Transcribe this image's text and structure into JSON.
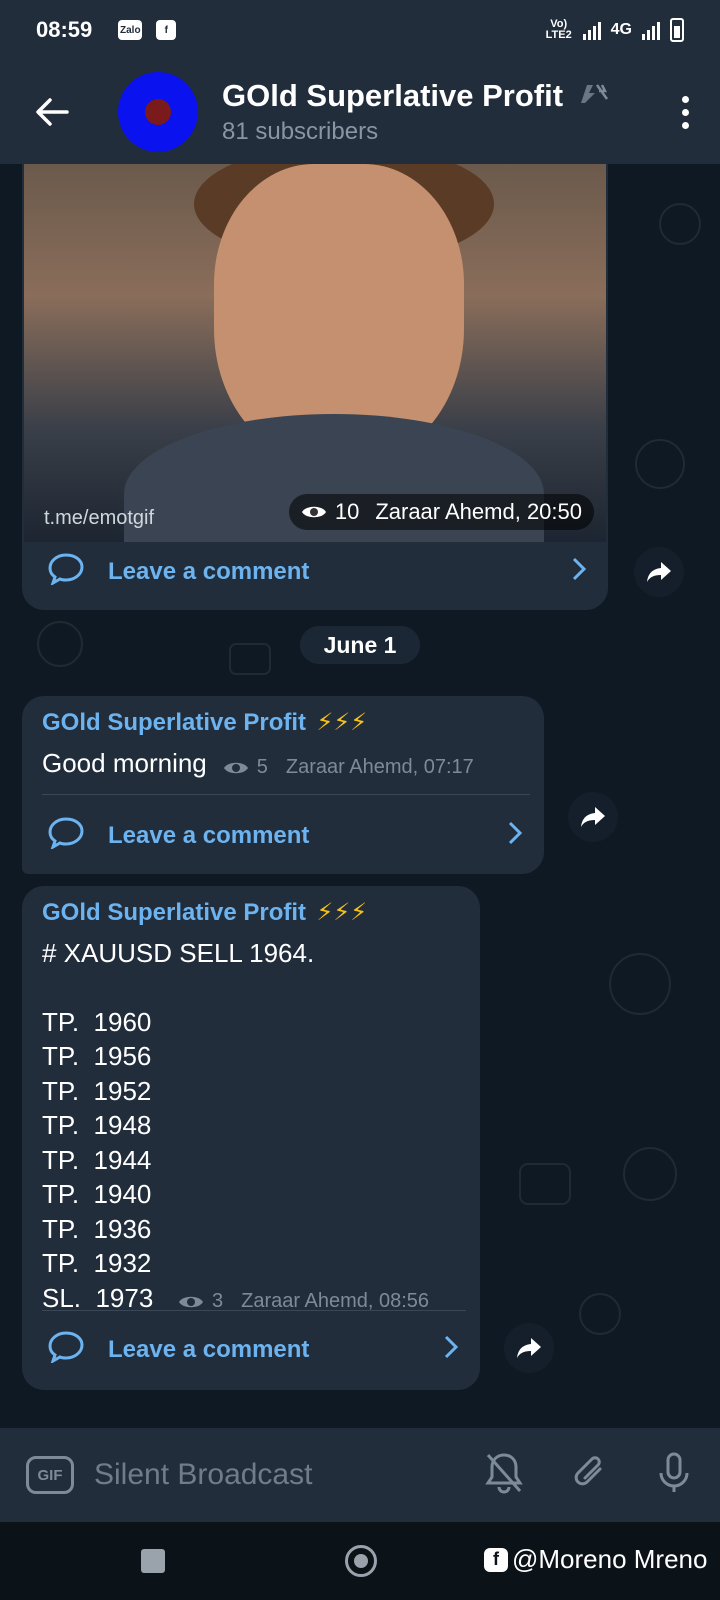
{
  "status": {
    "time": "08:59",
    "app_icons": [
      "Zalo",
      "f"
    ],
    "network_label": "Vo) LTE2",
    "cell_label": "4G"
  },
  "header": {
    "title": "GOld Superlative Profit",
    "subtitle": "81 subscribers"
  },
  "messages": [
    {
      "type": "media",
      "watermark": "t.me/emotgif",
      "views": "10",
      "author_time": "Zaraar Ahemd, 20:50",
      "comment_label": "Leave a comment"
    },
    {
      "type": "text",
      "sender": "GOld Superlative Profit",
      "bolts": "⚡⚡⚡",
      "text": "Good morning",
      "views": "5",
      "author_time": "Zaraar Ahemd, 07:17",
      "comment_label": "Leave a comment"
    },
    {
      "type": "signal",
      "sender": "GOld Superlative Profit",
      "bolts": "⚡⚡⚡",
      "headline": "# XAUUSD SELL 1964.",
      "lines": [
        "TP.  1960",
        "TP.  1956",
        "TP.  1952",
        "TP.  1948",
        "TP.  1944",
        "TP.  1940",
        "TP.  1936",
        "TP.  1932",
        "SL.  1973"
      ],
      "views": "3",
      "author_time": "Zaraar Ahemd, 08:56",
      "comment_label": "Leave a comment"
    }
  ],
  "date_separator": "June 1",
  "input": {
    "gif_label": "GIF",
    "placeholder": "Silent Broadcast"
  },
  "credit": "@Moreno Mreno",
  "colors": {
    "background": "#0f1923",
    "bar": "#212d3b",
    "accent": "#6cb3ef"
  }
}
